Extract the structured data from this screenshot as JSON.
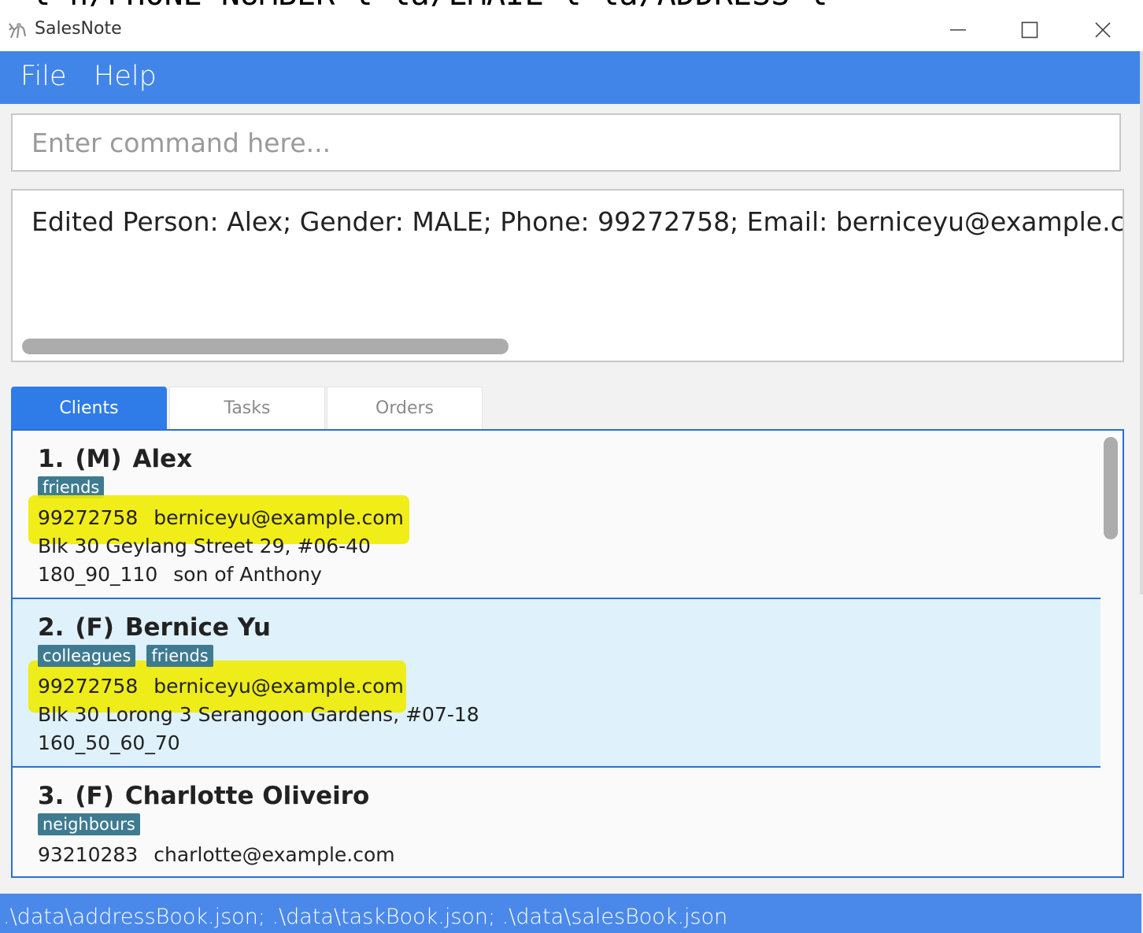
{
  "background_command": "l n/PHONE_NUMBER l la/EMAIL l la/ADDRESS l",
  "window": {
    "title": "SalesNote"
  },
  "menu": [
    "File",
    "Help"
  ],
  "command": {
    "placeholder": "Enter command here...",
    "value": ""
  },
  "result": {
    "text": "Edited Person: Alex; Gender: MALE; Phone: 99272758; Email: berniceyu@example.com; M"
  },
  "tabs": [
    "Clients",
    "Tasks",
    "Orders"
  ],
  "active_tab": "Clients",
  "clients": [
    {
      "index": "1.",
      "gender": "(M)",
      "name": "Alex",
      "tags": [
        "friends"
      ],
      "phone": "99272758",
      "email": "berniceyu@example.com",
      "address": "Blk 30 Geylang Street 29, #06-40",
      "sizes": "180_90_110",
      "remark": "son of Anthony"
    },
    {
      "index": "2.",
      "gender": "(F)",
      "name": "Bernice Yu",
      "tags": [
        "colleagues",
        "friends"
      ],
      "phone": "99272758",
      "email": "berniceyu@example.com",
      "address": "Blk 30 Lorong 3 Serangoon Gardens, #07-18",
      "sizes": "160_50_60_70",
      "remark": ""
    },
    {
      "index": "3.",
      "gender": "(F)",
      "name": "Charlotte Oliveiro",
      "tags": [
        "neighbours"
      ],
      "phone": "93210283",
      "email": "charlotte@example.com",
      "address": "",
      "sizes": "",
      "remark": ""
    }
  ],
  "status": {
    "text": ".\\data\\addressBook.json; .\\data\\taskBook.json; .\\data\\salesBook.json"
  },
  "colors": {
    "menubar": "#4285e8",
    "active_tab": "#2f7be8",
    "tag": "#3e7b91",
    "selected_card": "#dff1fb",
    "highlight": "#f0eb00"
  }
}
